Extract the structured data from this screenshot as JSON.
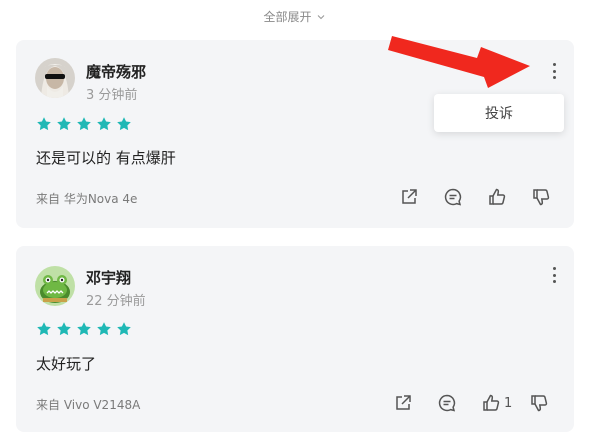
{
  "header": {
    "expand_all_label": "全部展开"
  },
  "reviews": [
    {
      "username": "魔帝殇邪",
      "time": "3 分钟前",
      "rating": 5,
      "comment": "还是可以的 有点爆肝",
      "device": "来自 华为Nova 4e",
      "likes": ""
    },
    {
      "username": "邓宇翔",
      "time": "22 分钟前",
      "rating": 5,
      "comment": "太好玩了",
      "device": "来自 Vivo V2148A",
      "likes": "1"
    }
  ],
  "popup": {
    "complain_label": "投诉"
  },
  "colors": {
    "star": "#1fb8b5",
    "arrow": "#f0281e",
    "card_bg": "#f4f5f7"
  },
  "icons": [
    "chevron-down-icon",
    "more-vertical-icon",
    "star-icon",
    "share-icon",
    "comment-icon",
    "thumbs-up-icon",
    "thumbs-down-icon",
    "arrow-annotation"
  ]
}
